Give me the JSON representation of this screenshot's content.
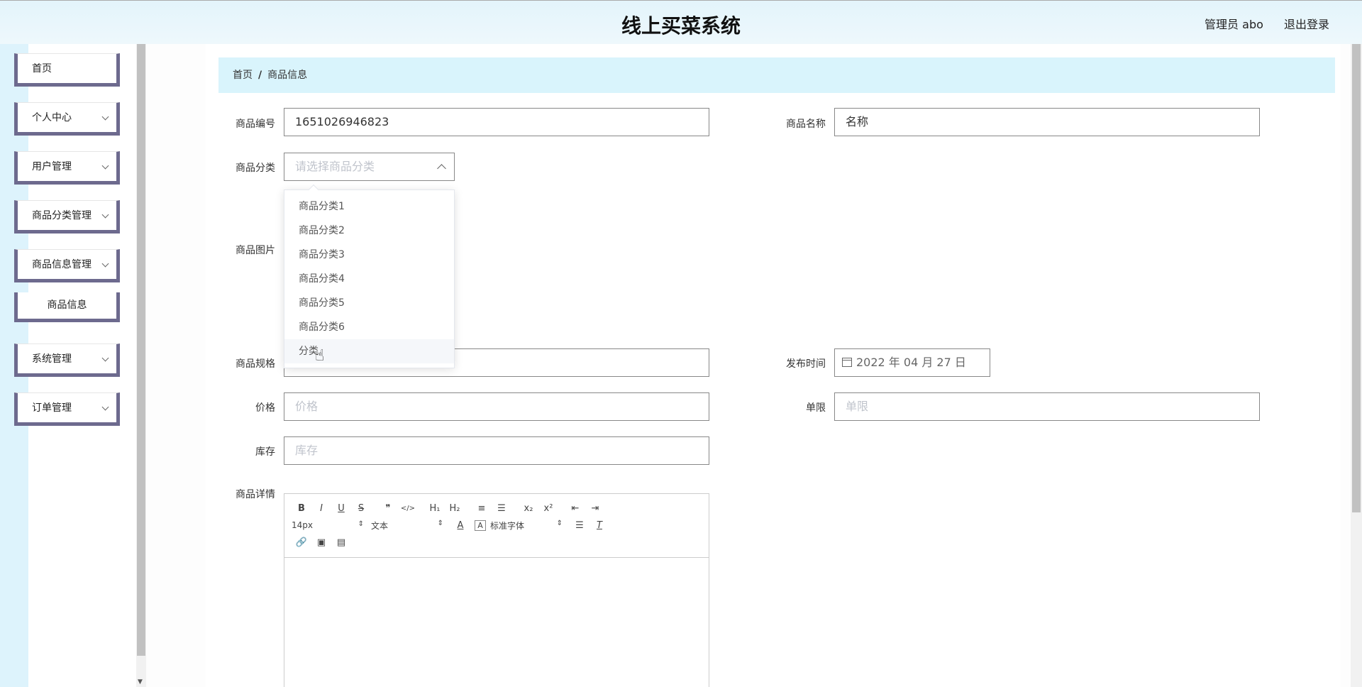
{
  "header": {
    "title": "线上买菜系统",
    "user": "管理员 abo",
    "logout": "退出登录"
  },
  "sidebar": {
    "items": [
      {
        "label": "首页"
      },
      {
        "label": "个人中心"
      },
      {
        "label": "用户管理"
      },
      {
        "label": "商品分类管理"
      },
      {
        "label": "商品信息管理"
      },
      {
        "label": "系统管理"
      },
      {
        "label": "订单管理"
      }
    ],
    "submenu": {
      "label": "商品信息"
    }
  },
  "breadcrumb": {
    "home": "首页",
    "separator": "/",
    "current": "商品信息"
  },
  "form": {
    "code": {
      "label": "商品编号",
      "value": "1651026946823"
    },
    "name": {
      "label": "商品名称",
      "value": "名称"
    },
    "category": {
      "label": "商品分类",
      "placeholder": "请选择商品分类"
    },
    "image": {
      "label": "商品图片"
    },
    "spec": {
      "label": "商品规格"
    },
    "publish": {
      "label": "发布时间",
      "value": "2022 年 04 月 27 日"
    },
    "price": {
      "label": "价格",
      "placeholder": "价格"
    },
    "limit": {
      "label": "单限",
      "placeholder": "单限"
    },
    "stock": {
      "label": "库存",
      "placeholder": "库存"
    },
    "detail": {
      "label": "商品详情"
    }
  },
  "dropdown": {
    "options": [
      "商品分类1",
      "商品分类2",
      "商品分类3",
      "商品分类4",
      "商品分类5",
      "商品分类6",
      "分类"
    ],
    "hovered_index": 6
  },
  "editor": {
    "toolbar_row1": [
      "B",
      "I",
      "U",
      "S",
      "❞",
      "</>",
      "H₁",
      "H₂",
      "≡",
      "☰",
      "x₂",
      "x²",
      "⇤",
      "⇥"
    ],
    "size": "14px",
    "header": "文本",
    "font": "标准字体",
    "toolbar_row3": [
      "🔗",
      "▣",
      "▤"
    ]
  }
}
